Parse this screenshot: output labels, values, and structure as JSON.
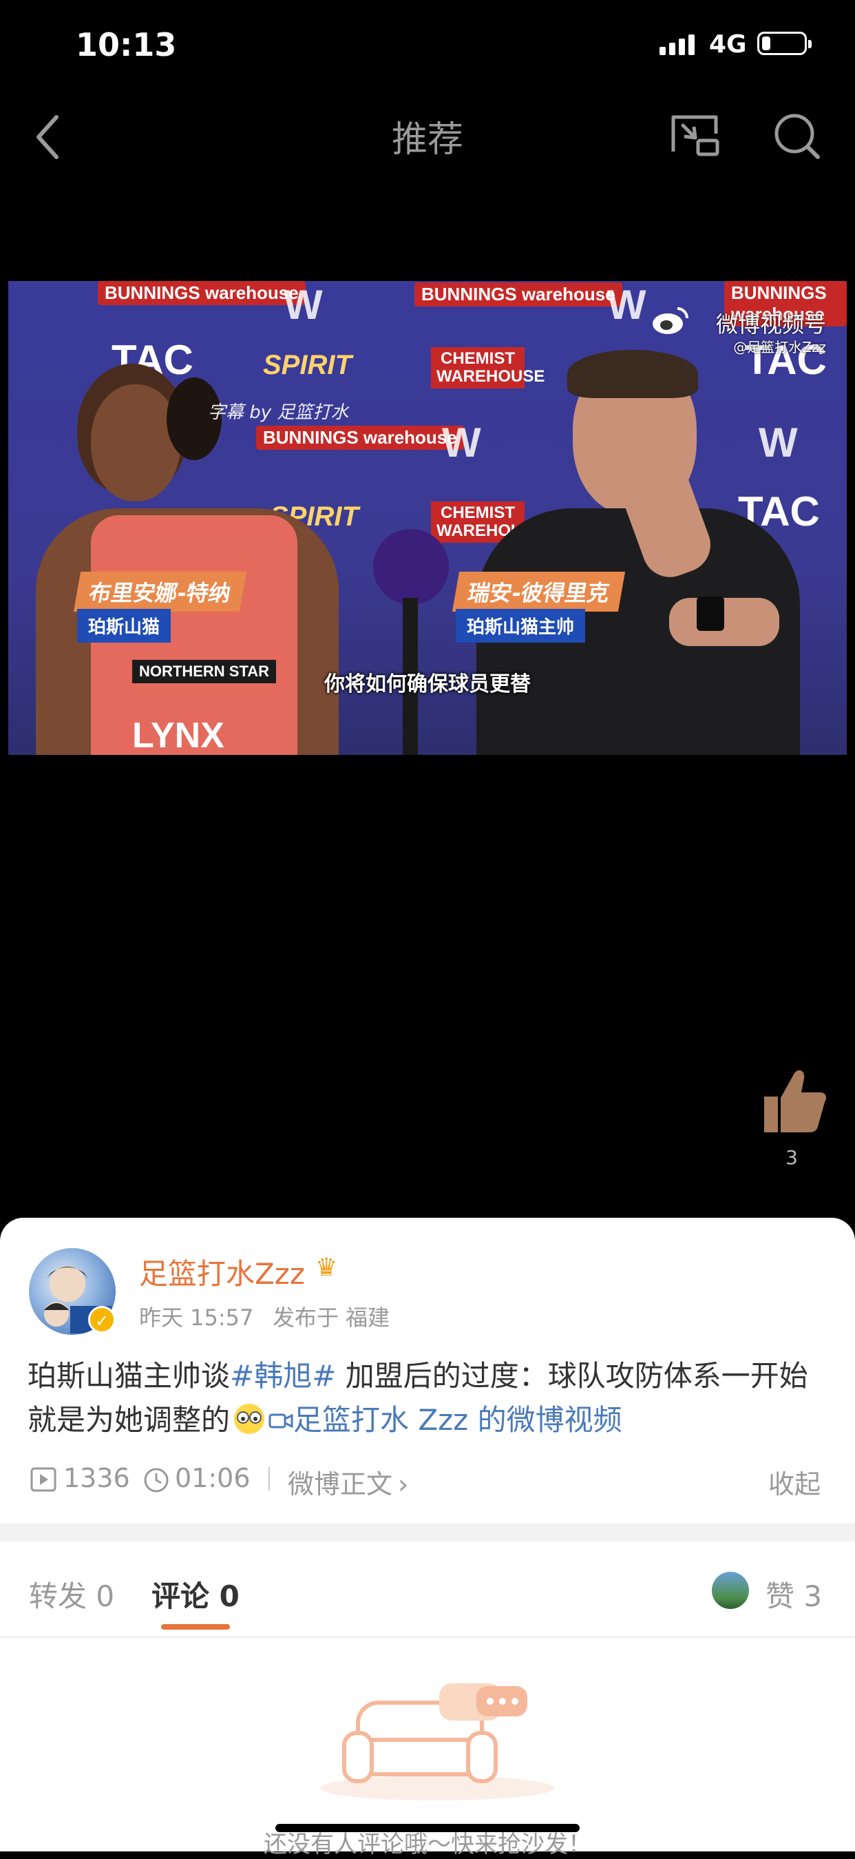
{
  "status_bar": {
    "time": "10:13",
    "network": "4G"
  },
  "nav": {
    "title": "推荐"
  },
  "video": {
    "watermark_text": "微博视频号",
    "watermark_handle": "@足篮打水Zzz",
    "subtitle_credit": "字幕 by 足篮打水",
    "player_left_name": "布里安娜-特纳",
    "player_left_team": "珀斯山猫",
    "player_right_name": "瑞安-彼得里克",
    "player_right_team": "珀斯山猫主帅",
    "subtitle": "你将如何确保球员更替",
    "sponsors": {
      "bunnings": "BUNNINGS warehouse",
      "tac": "TAC",
      "spirit": "SPIRIT",
      "chemist": "CHEMIST WAREHOUSE",
      "wnbl": "WNBL",
      "lynx": "LYNX",
      "northern_star": "NORTHERN STAR"
    }
  },
  "like_float": {
    "count": "3"
  },
  "post": {
    "author": "足篮打水Zzz",
    "time": "昨天 15:57",
    "location": "发布于 福建",
    "text_before": "珀斯山猫主帅谈",
    "hashtag": "#韩旭#",
    "text_after": " 加盟后的过度：球队攻防体系一开始就是为她调整的",
    "video_link": "足篮打水 Zzz 的微博视频",
    "plays": "1336",
    "duration": "01:06",
    "body_link": "微博正文",
    "collapse": "收起"
  },
  "tabs": {
    "repost_label": "转发",
    "repost_count": "0",
    "comment_label": "评论",
    "comment_count": "0",
    "like_label": "赞",
    "like_count": "3"
  },
  "empty_state": {
    "text": "还没有人评论哦～快来抢沙发！"
  },
  "colors": {
    "accent": "#e8743b",
    "link": "#4a7ab8",
    "background": "#000000"
  }
}
